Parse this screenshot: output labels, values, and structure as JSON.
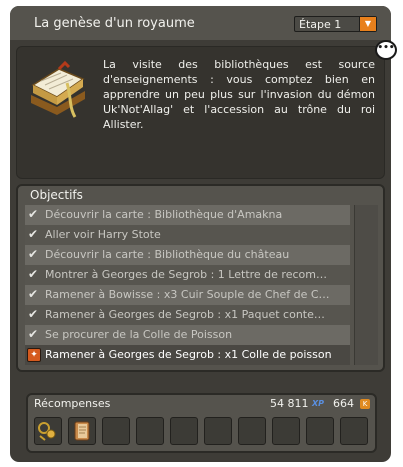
{
  "header": {
    "title": "La genèse d'un royaume",
    "step_label": "Étape 1"
  },
  "quest": {
    "description": "La visite des bibliothèques est source d'enseignements : vous comptez bien en apprendre un peu plus sur l'invasion du démon Uk'Not'Allag' et l'accession au trône du roi Allister."
  },
  "objectives": {
    "title": "Objectifs",
    "items": [
      {
        "label": "Découvrir la carte : Bibliothèque d'Amakna",
        "done": true
      },
      {
        "label": "Aller voir Harry Stote",
        "done": true
      },
      {
        "label": "Découvrir la carte : Bibliothèque du château",
        "done": true
      },
      {
        "label": "Montrer à Georges de Segrob : 1 Lettre de recom…",
        "done": true
      },
      {
        "label": "Ramener à Bowisse : x3 Cuir Souple de Chef de C…",
        "done": true
      },
      {
        "label": "Ramener à Georges de Segrob : x1 Paquet conte…",
        "done": true
      },
      {
        "label": "Se procurer de la Colle de Poisson",
        "done": true
      },
      {
        "label": "Ramener à Georges de Segrob : x1 Colle de poisson",
        "done": false
      }
    ]
  },
  "rewards": {
    "title": "Récompenses",
    "xp_value": "54 811",
    "xp_label": "XP",
    "kamas_value": "664",
    "kamas_label": "K",
    "items": [
      {
        "icon": "amulet-icon"
      },
      {
        "icon": "scroll-book-icon"
      }
    ],
    "slot_count": 10
  },
  "icons": {
    "check": "checkmark-icon",
    "active_objective": "target-icon",
    "quest": "book-icon",
    "chat": "chat-bubble-icon"
  },
  "colors": {
    "accent": "#e8801c",
    "xp": "#5a8fe0",
    "panel": "#3e3c37"
  }
}
